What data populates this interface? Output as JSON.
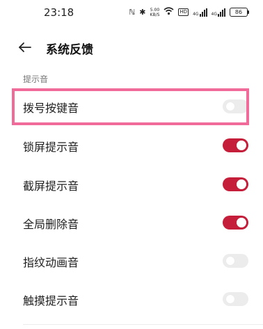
{
  "status_bar": {
    "time": "23:18",
    "nfc_icon": "ℕ",
    "bluetooth_icon": "✱",
    "speed_value": "5.00",
    "speed_unit": "KB/S",
    "hd_label": "HD",
    "network_1": "4G",
    "network_2": "4G",
    "battery": "86"
  },
  "header": {
    "back_icon": "arrow-left-icon",
    "title": "系统反馈"
  },
  "section": {
    "label": "提示音"
  },
  "settings": [
    {
      "label": "拨号按键音",
      "enabled": false,
      "highlighted": true
    },
    {
      "label": "锁屏提示音",
      "enabled": true,
      "highlighted": false
    },
    {
      "label": "截屏提示音",
      "enabled": true,
      "highlighted": false
    },
    {
      "label": "全局删除音",
      "enabled": true,
      "highlighted": false
    },
    {
      "label": "指纹动画音",
      "enabled": false,
      "highlighted": false
    },
    {
      "label": "触摸提示音",
      "enabled": false,
      "highlighted": false
    }
  ],
  "colors": {
    "toggle_on": "#c41e3a",
    "toggle_off": "#ececec",
    "highlight": "#f06a9a"
  }
}
